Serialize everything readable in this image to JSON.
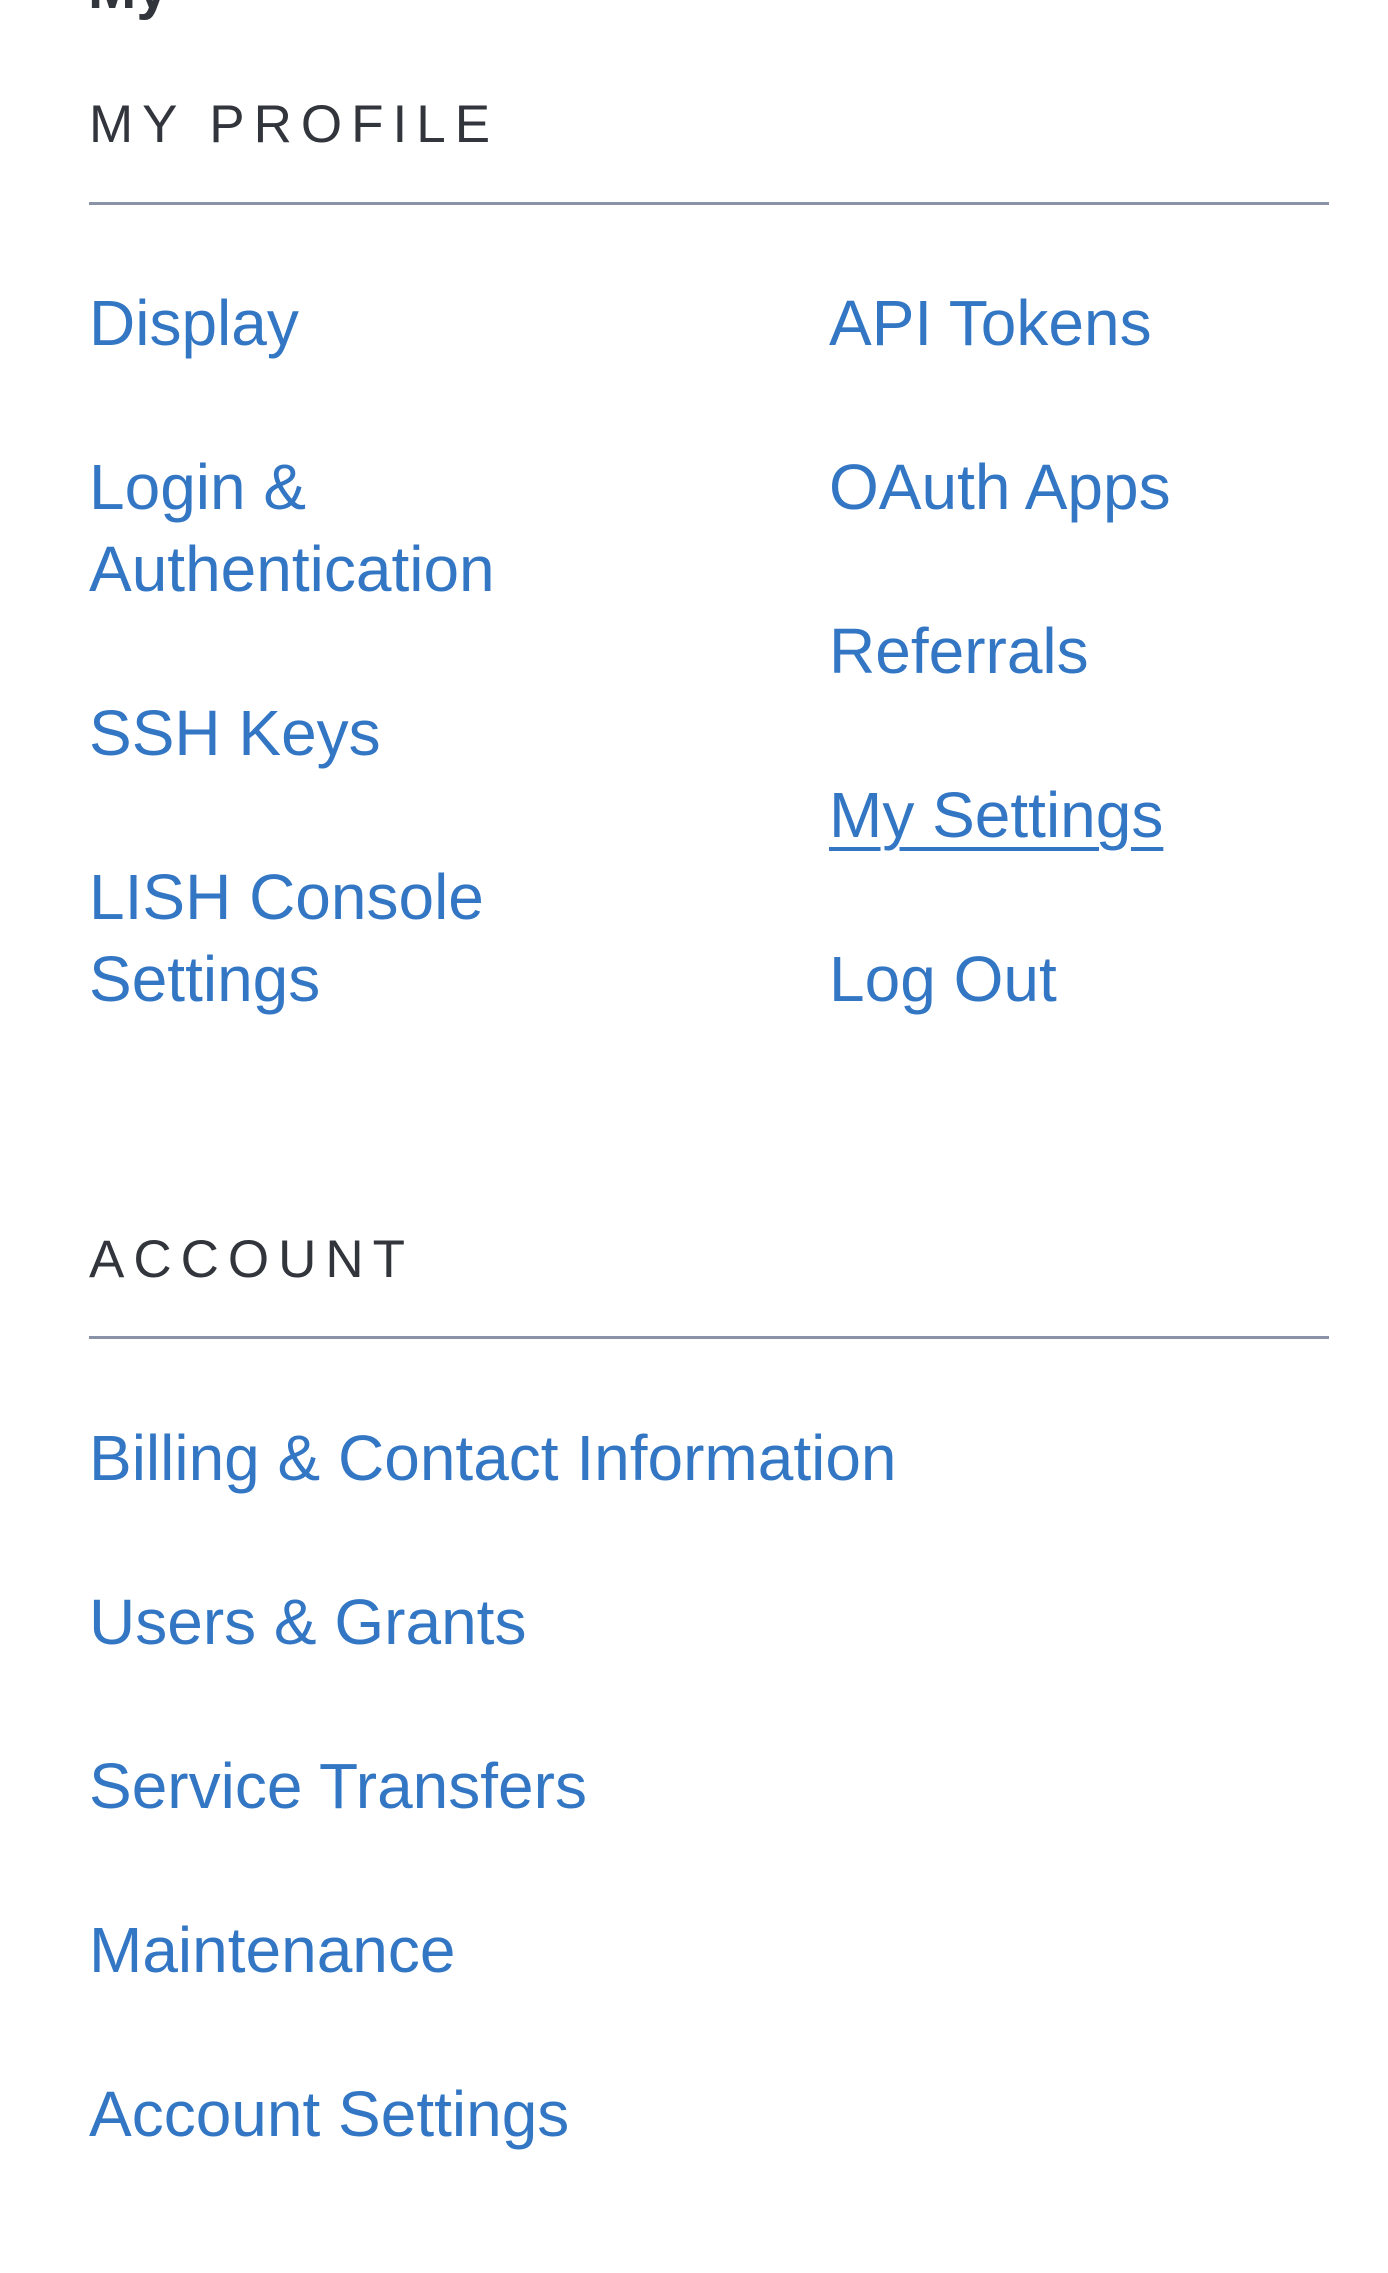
{
  "page": {
    "clipped_heading": "My"
  },
  "profile": {
    "title": "MY PROFILE",
    "left_links": [
      {
        "label": "Display"
      },
      {
        "label": "Login & Authentication"
      },
      {
        "label": "SSH Keys"
      },
      {
        "label": "LISH Console Settings"
      }
    ],
    "right_links": [
      {
        "label": "API Tokens"
      },
      {
        "label": "OAuth Apps"
      },
      {
        "label": "Referrals"
      },
      {
        "label": "My Settings",
        "active": true
      },
      {
        "label": "Log Out"
      }
    ]
  },
  "account": {
    "title": "ACCOUNT",
    "links": [
      {
        "label": "Billing & Contact Information"
      },
      {
        "label": "Users & Grants"
      },
      {
        "label": "Service Transfers"
      },
      {
        "label": "Maintenance"
      },
      {
        "label": "Account Settings"
      }
    ]
  },
  "colors": {
    "link": "#3276c4",
    "heading": "#32363c",
    "divider": "#8a92a8"
  }
}
